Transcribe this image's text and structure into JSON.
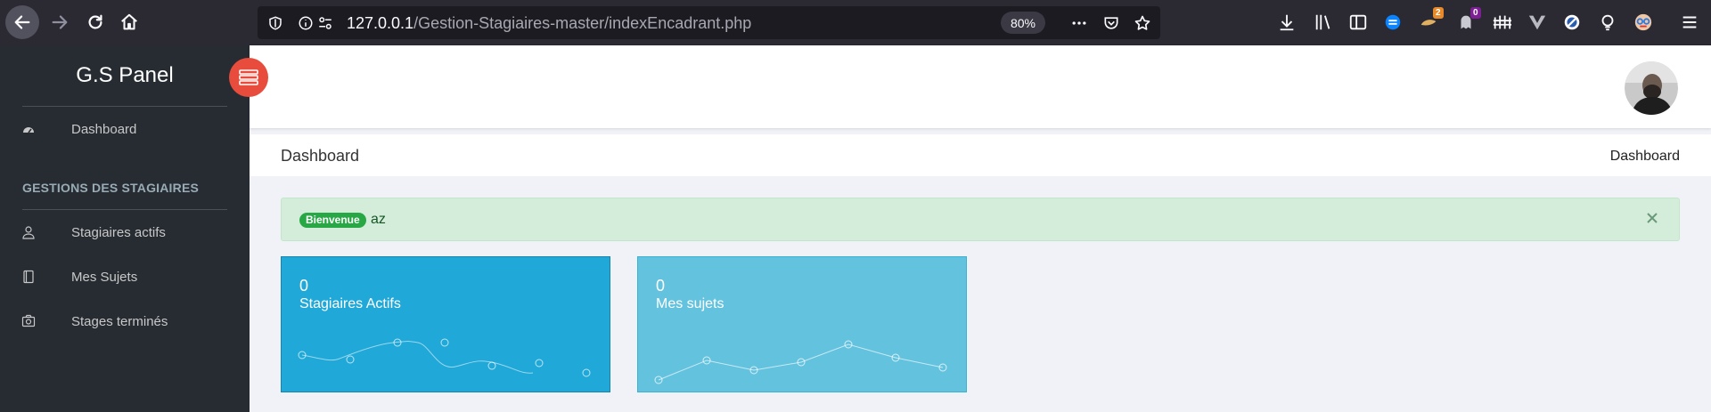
{
  "browser": {
    "url_host": "127.0.0.1",
    "url_path": "/Gestion-Stagiaires-master/indexEncadrant.php",
    "zoom": "80%",
    "badges": {
      "ext1": "2",
      "ext2": "0"
    }
  },
  "sidebar": {
    "brand": "G.S Panel",
    "items": [
      {
        "label": "Dashboard",
        "icon": "dashboard-icon"
      }
    ],
    "section_title": "GESTIONS DES STAGIAIRES",
    "section_items": [
      {
        "label": "Stagiaires actifs",
        "icon": "user-icon"
      },
      {
        "label": "Mes Sujets",
        "icon": "book-icon"
      },
      {
        "label": "Stages terminés",
        "icon": "camera-icon"
      }
    ]
  },
  "page": {
    "title": "Dashboard",
    "breadcrumb": "Dashboard"
  },
  "alert": {
    "badge": "Bienvenue",
    "text": "az"
  },
  "cards": [
    {
      "value": "0",
      "label": "Stagiaires Actifs",
      "color": "#20a8d8"
    },
    {
      "value": "0",
      "label": "Mes sujets",
      "color": "#63c2de"
    }
  ],
  "colors": {
    "sidebar_bg": "#272c33",
    "toggle_btn": "#e74c3c",
    "alert_badge": "#28a745"
  }
}
